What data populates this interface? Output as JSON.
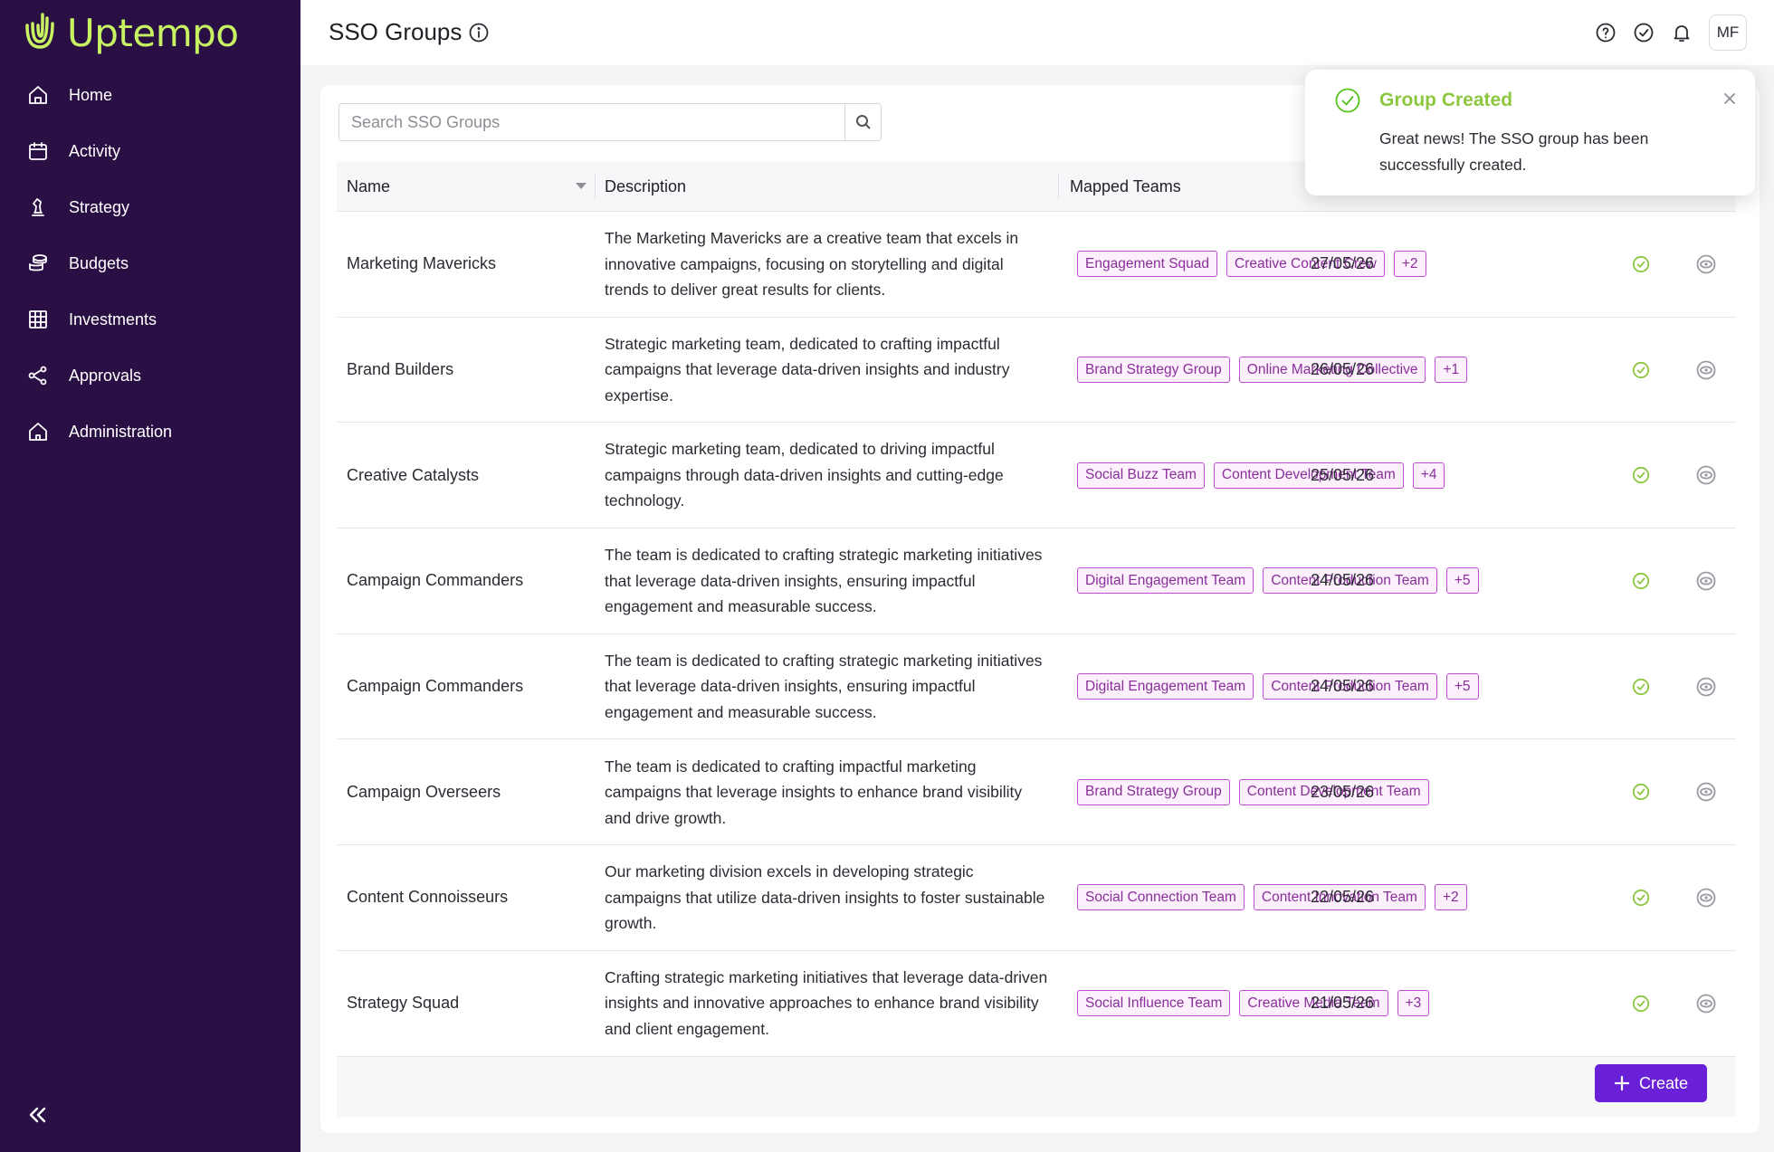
{
  "app": {
    "brand": "Uptempo",
    "brand_color": "#c7f262",
    "sidebar_bg": "#2a0f45",
    "accent": "#6a20d6"
  },
  "sidebar": {
    "items": [
      {
        "label": "Home",
        "icon": "home-icon"
      },
      {
        "label": "Activity",
        "icon": "calendar-icon"
      },
      {
        "label": "Strategy",
        "icon": "chess-icon"
      },
      {
        "label": "Budgets",
        "icon": "coins-icon"
      },
      {
        "label": "Investments",
        "icon": "grid-icon"
      },
      {
        "label": "Approvals",
        "icon": "share-nodes-icon"
      },
      {
        "label": "Administration",
        "icon": "admin-home-icon"
      }
    ],
    "collapse_icon": "double-chevron-left-icon"
  },
  "header": {
    "title": "SSO Groups",
    "avatar": "MF",
    "icons": [
      "help-icon",
      "check-circle-icon",
      "bell-icon"
    ]
  },
  "search": {
    "placeholder": "Search SSO Groups"
  },
  "table": {
    "columns": {
      "name": "Name",
      "description": "Description",
      "mapped_teams": "Mapped Teams"
    },
    "rows": [
      {
        "name": "Marketing Mavericks",
        "description": "The Marketing Mavericks are a creative team that excels in innovative campaigns, focusing on storytelling and digital trends to deliver great results for clients.",
        "teams": [
          "Engagement Squad",
          "Creative Content Crew"
        ],
        "more": "+2",
        "date": "27/05/26"
      },
      {
        "name": "Brand Builders",
        "description": "Strategic marketing team, dedicated to crafting impactful campaigns that leverage data-driven insights and industry expertise.",
        "teams": [
          "Brand Strategy Group",
          "Online Marketing Collective"
        ],
        "more": "+1",
        "date": "26/05/26"
      },
      {
        "name": "Creative Catalysts",
        "description": "Strategic marketing team, dedicated to driving impactful campaigns through data-driven insights and cutting-edge technology.",
        "teams": [
          "Social Buzz Team",
          "Content Development Team"
        ],
        "more": "+4",
        "date": "25/05/26"
      },
      {
        "name": "Campaign Commanders",
        "description": "The team is dedicated to crafting strategic marketing initiatives that leverage data-driven insights, ensuring impactful engagement and measurable success.",
        "teams": [
          "Digital Engagement Team",
          "Content Production Team"
        ],
        "more": "+5",
        "date": "24/05/26"
      },
      {
        "name": "Campaign Commanders",
        "description": "The team is dedicated to crafting strategic marketing initiatives that leverage data-driven insights, ensuring impactful engagement and measurable success.",
        "teams": [
          "Digital Engagement Team",
          "Content Production Team"
        ],
        "more": "+5",
        "date": "24/05/26"
      },
      {
        "name": "Campaign Overseers",
        "description": "The team is dedicated to crafting impactful marketing campaigns that leverage insights to enhance brand visibility and drive growth.",
        "teams": [
          "Brand Strategy Group",
          "Content Development Team"
        ],
        "more": "",
        "date": "23/05/26"
      },
      {
        "name": "Content Connoisseurs",
        "description": "Our marketing division excels in developing strategic campaigns that utilize data-driven insights to foster sustainable growth.",
        "teams": [
          "Social Connection Team",
          "Content Innovation Team"
        ],
        "more": "+2",
        "date": "22/05/26"
      },
      {
        "name": "Strategy Squad",
        "description": "Crafting strategic marketing initiatives that leverage data-driven insights and innovative approaches to enhance brand visibility and client engagement.",
        "teams": [
          "Social Influence Team",
          "Creative Media Team"
        ],
        "more": "+3",
        "date": "21/05/26"
      }
    ]
  },
  "footer": {
    "create_label": "Create"
  },
  "toast": {
    "title": "Group Created",
    "message": "Great news! The SSO group has been successfully created.",
    "status_color": "#8dc63f"
  }
}
